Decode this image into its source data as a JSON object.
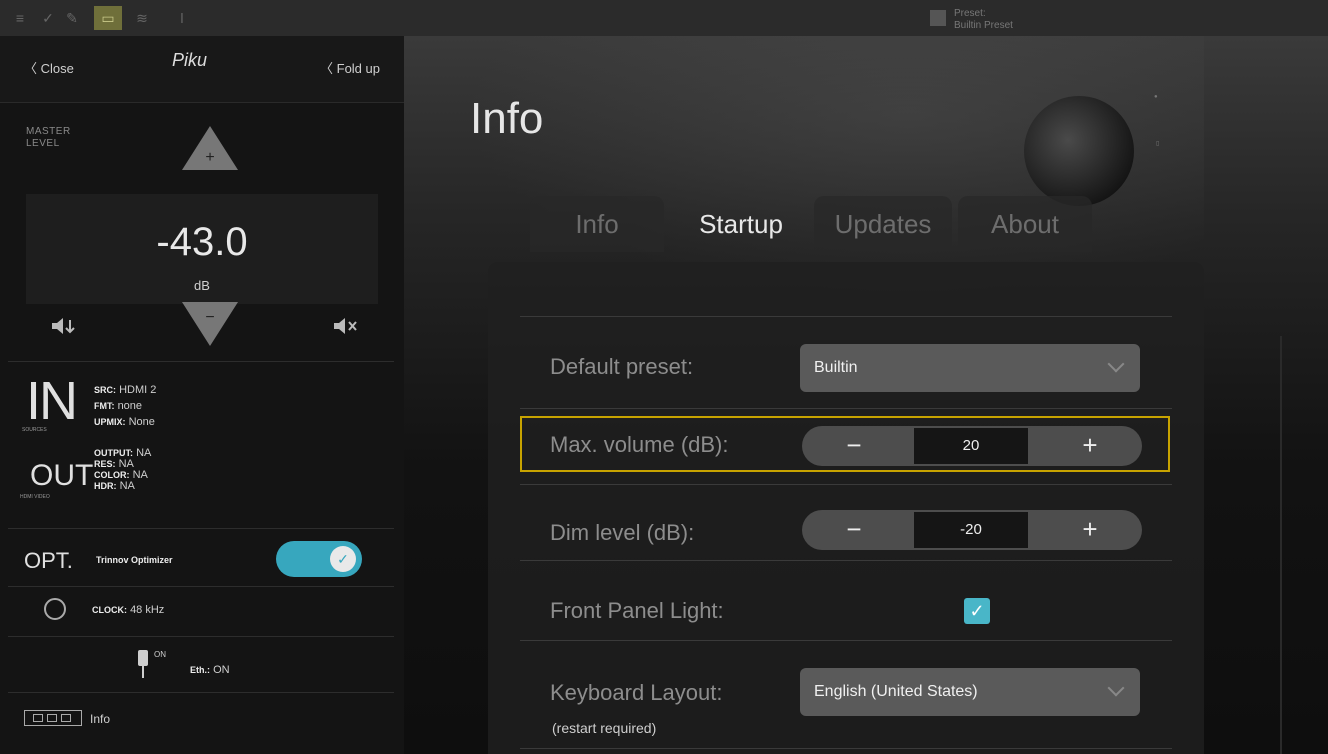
{
  "topbar": {
    "preset_line1": "Preset:",
    "preset_line2": "Builtin Preset"
  },
  "left": {
    "close_label": "Close",
    "logo_text": "Piku",
    "foldup_label": "Fold up",
    "master_level_label": "MASTER LEVEL",
    "level_value": "-43.0",
    "level_unit": "dB",
    "inputs": {
      "big": "IN",
      "sub": "SOURCES",
      "src_key": "SRC:",
      "src_val": "HDMI 2",
      "fmt_key": "FMT:",
      "fmt_val": "none",
      "upmix_key": "UPMIX:",
      "upmix_val": "None"
    },
    "outputs": {
      "big": "OUT",
      "sub": "HDMI VIDEO",
      "output_key": "OUTPUT:",
      "output_val": "NA",
      "res_key": "RES:",
      "res_val": "NA",
      "color_key": "COLOR:",
      "color_val": "NA",
      "hdr_key": "HDR:",
      "hdr_val": "NA"
    },
    "optimizer": {
      "big": "OPT.",
      "label": "Trinnov Optimizer",
      "enabled": true,
      "knob_glyph": "✓"
    },
    "clock": {
      "key": "CLOCK:",
      "val": "48 kHz"
    },
    "ethernet": {
      "side": "ON",
      "key": "Eth.:",
      "val": "ON"
    },
    "info_label": "Info"
  },
  "main": {
    "title": "Info",
    "tabs": [
      {
        "label": "Info",
        "active": false
      },
      {
        "label": "Startup",
        "active": true
      },
      {
        "label": "Updates",
        "active": false
      },
      {
        "label": "About",
        "active": false
      }
    ],
    "fields": {
      "default_preset_label": "Default preset:",
      "default_preset_value": "Builtin",
      "max_volume_label": "Max. volume (dB):",
      "max_volume_value": "20",
      "dim_level_label": "Dim level (dB):",
      "dim_level_value": "-20",
      "front_panel_label": "Front Panel Light:",
      "front_panel_checked": true,
      "keyboard_label": "Keyboard Layout:",
      "keyboard_sub": "(restart required)",
      "keyboard_value": "English (United States)"
    },
    "stepper_minus": "−",
    "stepper_plus": "+",
    "check_glyph": "✓"
  },
  "colors": {
    "accent": "#37a7be",
    "highlight": "#c7a300"
  }
}
